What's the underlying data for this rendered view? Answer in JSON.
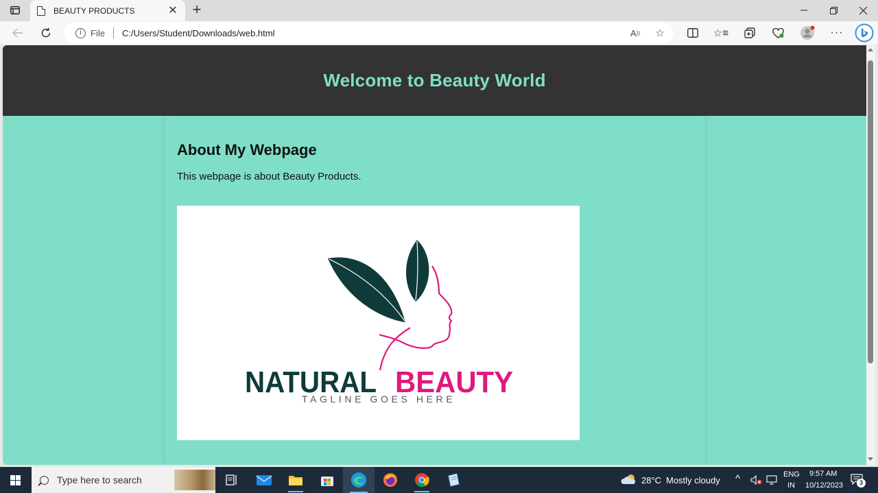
{
  "browser": {
    "tab_title": "BEAUTY PRODUCTS",
    "file_label": "File",
    "url": "C:/Users/Student/Downloads/web.html"
  },
  "page": {
    "header_title": "Welcome to Beauty World",
    "about_title": "About My Webpage",
    "about_text": "This webpage is about Beauty Products.",
    "logo": {
      "brand_word_1": "NATURAL",
      "brand_word_2": "BEAUTY",
      "tagline": "TAGLINE GOES HERE",
      "colors": {
        "dark": "#0f3b3a",
        "pink": "#e0197d"
      }
    }
  },
  "taskbar": {
    "search_placeholder": "Type here to search",
    "weather_temp": "28°C",
    "weather_text": "Mostly cloudy",
    "language": "ENG",
    "region": "IN",
    "time": "9:57 AM",
    "date": "10/12/2023",
    "notification_count": "3"
  },
  "colors": {
    "page_bg": "#7fdec7",
    "header_bg": "#333333",
    "header_text": "#7fdec7"
  }
}
